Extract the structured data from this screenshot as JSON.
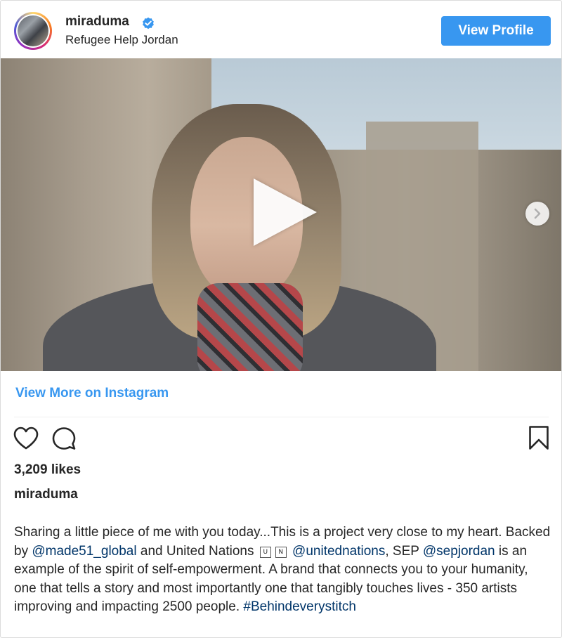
{
  "header": {
    "username": "miraduma",
    "verified": true,
    "location": "Refugee Help Jordan",
    "view_profile_label": "View Profile"
  },
  "media": {
    "type": "video",
    "icons": [
      "play-icon",
      "chevron-right-icon"
    ]
  },
  "view_more_label": "View More on Instagram",
  "actions": {
    "icons": [
      "heart-icon",
      "comment-icon",
      "bookmark-icon"
    ]
  },
  "likes_text": "3,209 likes",
  "author": "miraduma",
  "caption": {
    "t1": "Sharing a little piece of me with you today...This is a project very close to my heart. Backed by ",
    "m1": "@made51_global",
    "t2": " and United Nations ",
    "g1": "U",
    "g2": "N",
    "m2": "@unitednations",
    "t3": ", SEP ",
    "m3": "@sepjordan",
    "t4": " is an example of the spirit of self-empowerment. A brand that connects you to your humanity, one that tells a story and most importantly one that tangibly touches lives - 350 artists improving and impacting 2500 people. ",
    "h1": "#Behindeverystitch"
  },
  "colors": {
    "accent": "#3897f0",
    "link": "#003569",
    "text": "#262626",
    "border": "#dbdbdb"
  }
}
